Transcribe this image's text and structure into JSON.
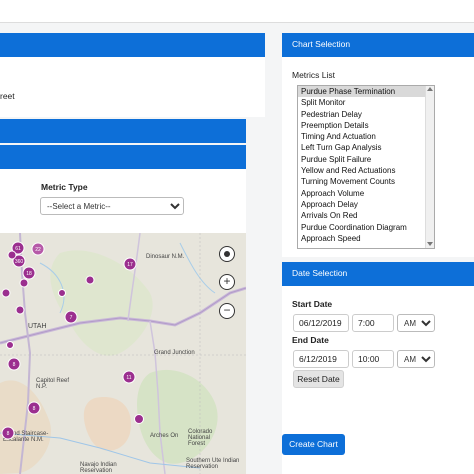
{
  "left_panel": {
    "street_text": "reet",
    "metric_type_label": "Metric Type",
    "metric_select_value": "--Select a Metric--"
  },
  "map": {
    "labels": [
      "UTAH",
      "Dinosaur N.M.",
      "Grand Junction",
      "Capitol Reef N.P.",
      "Grand Staircase-Escalante N.M.",
      "Colorado National Forest",
      "Southern Ute Indian Reservation",
      "Navajo Indian Reservation",
      "Arches On"
    ],
    "markers": [
      "61",
      "22",
      "360",
      "18",
      "17",
      "7",
      "8",
      "8",
      "11",
      "8"
    ],
    "controls": {
      "locate_icon": "crosshair-icon",
      "zoom_in": "+",
      "zoom_out": "−"
    }
  },
  "chart_selection": {
    "header": "Chart Selection",
    "metrics_list_label": "Metrics List",
    "selected": "Purdue Phase Termination",
    "items": [
      "Purdue Phase Termination",
      "Split Monitor",
      "Pedestrian Delay",
      "Preemption Details",
      "Timing And Actuation",
      "Left Turn Gap Analysis",
      "Purdue Split Failure",
      "Yellow and Red Actuations",
      "Turning Movement Counts",
      "Approach Volume",
      "Approach Delay",
      "Arrivals On Red",
      "Purdue Coordination Diagram",
      "Approach Speed"
    ]
  },
  "date_selection": {
    "header": "Date Selection",
    "start_label": "Start Date",
    "start_date": "06/12/2019",
    "start_time": "7:00",
    "start_ampm": "AM",
    "end_label": "End Date",
    "end_date": "6/12/2019",
    "end_time": "10:00",
    "end_ampm": "AM",
    "reset_button": "Reset Date"
  },
  "create_chart_button": "Create Chart",
  "colors": {
    "accent": "#0d6fd8",
    "marker": "#9b2f8f"
  }
}
